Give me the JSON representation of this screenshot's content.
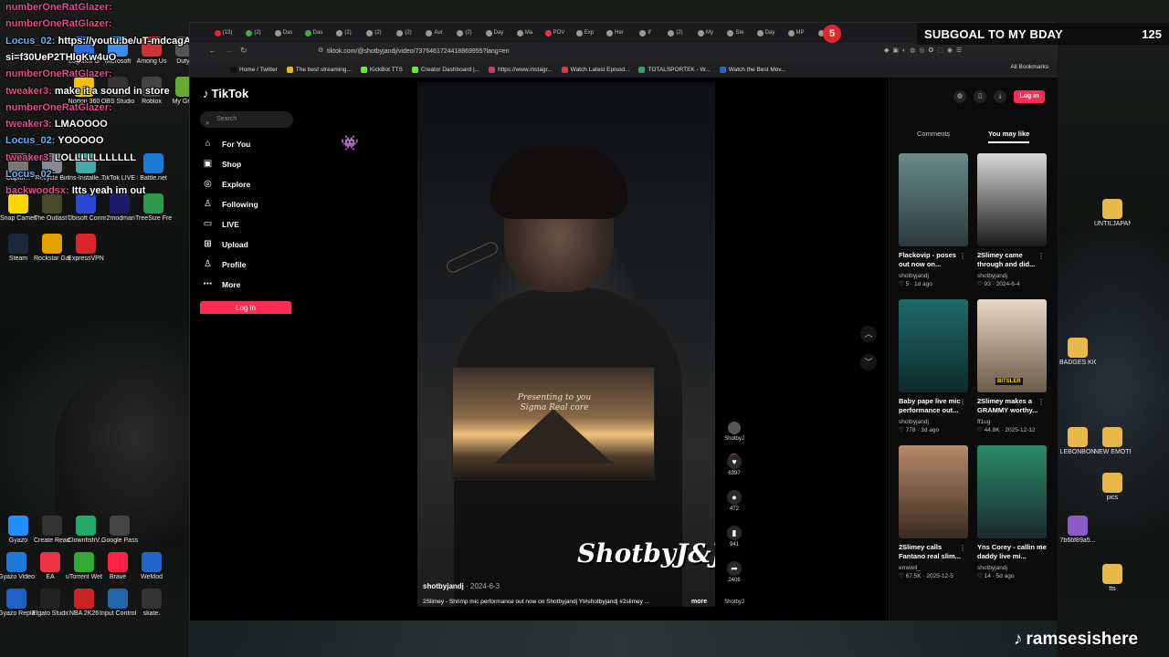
{
  "stream_overlay": {
    "sub_badge_count": "5",
    "sub_goal_label": "SUBGOAL TO MY BDAY",
    "sub_goal_count": "125",
    "streamer_name": "ramsesishere"
  },
  "chat": [
    {
      "user": "numberOneRatGlazer:",
      "msg": ""
    },
    {
      "user": "numberOneRatGlazer:",
      "msg": ""
    },
    {
      "user": "Locus_02:",
      "msg": "https://youtu.be/uT-mdcagAU0?"
    },
    {
      "user": "",
      "msg": "si=f30UeP2THlgKw4uO"
    },
    {
      "user": "numberOneRatGlazer:",
      "msg": ""
    },
    {
      "user": "tweaker3:",
      "msg": "make it a sound in store"
    },
    {
      "user": "numberOneRatGlazer:",
      "msg": ""
    },
    {
      "user": "tweaker3:",
      "msg": "LMAOOOO"
    },
    {
      "user": "Locus_02:",
      "msg": "YOOOOO"
    },
    {
      "user": "tweaker3:",
      "msg": "LOLLLLLLLLLLL"
    },
    {
      "user": "Locus_02:",
      "msg": ""
    },
    {
      "user": "backwoodsx:",
      "msg": "Itts yeah im out"
    }
  ],
  "desktop_left": [
    {
      "label": "Logitech G",
      "color": "#2f6bd8"
    },
    {
      "label": "Microsoft",
      "color": "#3a8ee8"
    },
    {
      "label": "Among Us",
      "color": "#c33"
    },
    {
      "label": "Duty®",
      "color": "#555"
    },
    {
      "label": "Norton 360",
      "color": "#f2c200"
    },
    {
      "label": "OBS Studio",
      "color": "#333"
    },
    {
      "label": "Roblox",
      "color": "#444"
    },
    {
      "label": "My Great",
      "color": "#6a3"
    },
    {
      "label": "Captur...",
      "color": "#777"
    },
    {
      "label": "Recycle Bin",
      "color": "#889"
    },
    {
      "label": "Iris-Installe...",
      "color": "#4aa"
    },
    {
      "label": "TikTok LIVE Studio",
      "color": "#111"
    },
    {
      "label": "Battle.net",
      "color": "#1b7ad6"
    },
    {
      "label": "Snap Camera",
      "color": "#ffd500"
    },
    {
      "label": "The Outlast Trials",
      "color": "#4a4a2a"
    },
    {
      "label": "Ubisoft Connect",
      "color": "#2a4ad6"
    },
    {
      "label": "r2modman",
      "color": "#1b1b6b"
    },
    {
      "label": "TreeSize Free",
      "color": "#2c9a4a"
    },
    {
      "label": "Steam",
      "color": "#1b2838"
    },
    {
      "label": "Rockstar Games ...",
      "color": "#e6a000"
    },
    {
      "label": "ExpressVPN",
      "color": "#d9262b"
    }
  ],
  "desktop_bottom_left": [
    {
      "label": "Gyazo",
      "color": "#1e90ff"
    },
    {
      "label": "Create React App Sample",
      "color": "#333"
    },
    {
      "label": "ClownfishV...",
      "color": "#2a6"
    },
    {
      "label": "Google Passwo...",
      "color": "#444"
    },
    {
      "label": "Gyazo Video",
      "color": "#1e78d6"
    },
    {
      "label": "EA",
      "color": "#e34"
    },
    {
      "label": "uTorrent Web",
      "color": "#3a3"
    },
    {
      "label": "Brave",
      "color": "#f24"
    },
    {
      "label": "WeMod",
      "color": "#26c"
    },
    {
      "label": "Gyazo Replay",
      "color": "#1e60c6"
    },
    {
      "label": "Elgato Studio",
      "color": "#222"
    },
    {
      "label": "NBA 2K26",
      "color": "#c22"
    },
    {
      "label": "Input Control Deck.exe",
      "color": "#26a"
    },
    {
      "label": "skate.",
      "color": "#333"
    }
  ],
  "desktop_right": [
    {
      "label": "UNTILJAPAN PRESET PA...",
      "color": "#e8b84a"
    },
    {
      "label": "BADGES KICK",
      "color": "#e8b84a"
    },
    {
      "label": "LEBONBON",
      "color": "#e8b84a"
    },
    {
      "label": "NEW EMOTES",
      "color": "#e8b84a"
    },
    {
      "label": "pics",
      "color": "#e8b84a"
    },
    {
      "label": "7b6bf89a5...",
      "color": "#8a5ac8"
    },
    {
      "label": "tts",
      "color": "#e8b84a"
    }
  ],
  "browser": {
    "url": "tiktok.com/@shotbyjandj/video/7376461724418869955?lang=en",
    "bookmarks": [
      {
        "label": "Home / Twitter",
        "color": "#111"
      },
      {
        "label": "The best streaming...",
        "color": "#f4b400"
      },
      {
        "label": "KickBot TTS",
        "color": "#53fc18"
      },
      {
        "label": "Creator Dashboard |...",
        "color": "#53fc18"
      },
      {
        "label": "https://www.instagr...",
        "color": "#e1306c"
      },
      {
        "label": "Watch Latest Episod...",
        "color": "#e34"
      },
      {
        "label": "TOTALSPORTEK - W...",
        "color": "#2a6"
      },
      {
        "label": "Watch the Best Mov...",
        "color": "#26c"
      }
    ],
    "all_bookmarks": "All Bookmarks",
    "tabs": [
      "(13)",
      "(2)",
      "Das",
      "Das",
      "(2)",
      "(2)",
      "(2)",
      "Aur",
      "(2)",
      "Day",
      "Ma",
      "POV",
      "Exp",
      "Her",
      "If",
      "(2)",
      "My",
      "Ste",
      "Day",
      "MP",
      "(2)"
    ]
  },
  "tiktok": {
    "logo": "TikTok",
    "search_placeholder": "Search",
    "nav": [
      {
        "label": "For You",
        "icon": "home-icon",
        "glyph": "⌂"
      },
      {
        "label": "Shop",
        "icon": "shop-icon",
        "glyph": "▣"
      },
      {
        "label": "Explore",
        "icon": "compass-icon",
        "glyph": "◎"
      },
      {
        "label": "Following",
        "icon": "user-plus-icon",
        "glyph": "♙"
      },
      {
        "label": "LIVE",
        "icon": "live-icon",
        "glyph": "▭"
      },
      {
        "label": "Upload",
        "icon": "plus-square-icon",
        "glyph": "⊞"
      },
      {
        "label": "Profile",
        "icon": "profile-icon",
        "glyph": "♙"
      },
      {
        "label": "More",
        "icon": "more-icon",
        "glyph": "⋯"
      }
    ],
    "login_side": "Log in",
    "login_top": "Log in",
    "video": {
      "author": "shotbyjandj",
      "date": "2024-6-3",
      "caption": "2Slimey - Shrimp mic performance out now on Shotbyjandj Yt#shotbyjandj #2slimey ...",
      "more": "more",
      "inset_text_1": "Presenting to you",
      "inset_text_2": "Sigma Real core",
      "watermark": "ShotbyJ&J",
      "progress": 0.63
    },
    "actions": [
      {
        "name": "like",
        "glyph": "♥",
        "count": "6397"
      },
      {
        "name": "comment",
        "glyph": "●",
        "count": "472"
      },
      {
        "name": "save",
        "glyph": "▮",
        "count": "941"
      },
      {
        "name": "share",
        "glyph": "➦",
        "count": "2406"
      }
    ],
    "rail_avatar_label": "ShotbyJ",
    "rail_bottom_label": "ShotbyJ",
    "right_tabs": {
      "comments": "Comments",
      "you_may_like": "You may like"
    },
    "cards": [
      {
        "title": "Flackovip - poses out now on...",
        "author": "shotbyjandj",
        "stats": "♡ 5 · 1d ago",
        "bg": "linear-gradient(180deg,#6a8a88,#2c3a3a)"
      },
      {
        "title": "2Slimey came through and did...",
        "author": "shotbyjandj",
        "stats": "♡ 93 · 2024-6-4",
        "bg": "linear-gradient(180deg,#d8d8d8,#1a1a1a)"
      },
      {
        "title": "Baby pape live mic performance out...",
        "author": "shotbyjandj",
        "stats": "♡ 778 · 3d ago",
        "bg": "linear-gradient(180deg,#1e6a6a,#0e2a2a)"
      },
      {
        "title": "2Slimey makes a GRAMMY worthy...",
        "author": "ff1ug",
        "stats": "♡ 44.8K · 2025-12-12",
        "bg": "linear-gradient(180deg,#e8d8c8,#6a5a4a)"
      },
      {
        "title": "2Slimey calls Fantano real slim...",
        "author": "emwell_",
        "stats": "♡ 67.5K · 2025-12-5",
        "bg": "linear-gradient(180deg,#b88a6a,#3a2a22)"
      },
      {
        "title": "Yns Corey - callin me daddy live mi...",
        "author": "shotbyjandj",
        "stats": "♡ 14 · 5d ago",
        "bg": "linear-gradient(180deg,#2a8a6a,#1a2a2a)"
      }
    ],
    "card_badge_4": "BITSLER"
  }
}
